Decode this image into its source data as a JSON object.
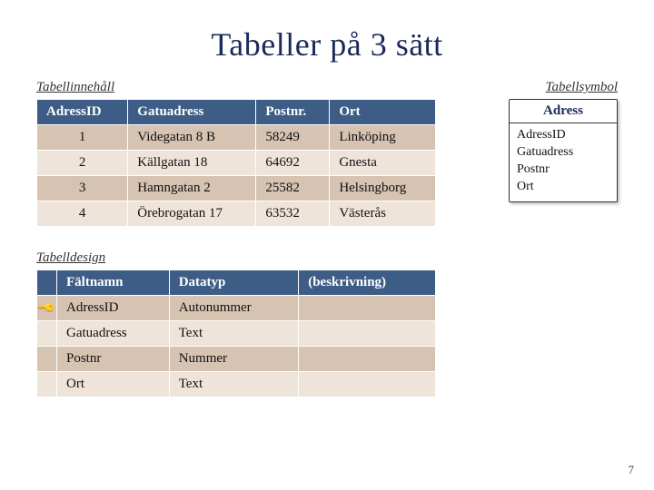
{
  "title": "Tabeller på 3 sätt",
  "labels": {
    "content": "Tabellinnehåll",
    "symbol": "Tabellsymbol",
    "design": "Tabelldesign"
  },
  "content_table": {
    "headers": {
      "id": "AdressID",
      "street": "Gatuadress",
      "zip": "Postnr.",
      "city": "Ort"
    },
    "rows": [
      {
        "id": "1",
        "street": "Videgatan 8 B",
        "zip": "58249",
        "city": "Linköping"
      },
      {
        "id": "2",
        "street": "Källgatan 18",
        "zip": "64692",
        "city": "Gnesta"
      },
      {
        "id": "3",
        "street": "Hamngatan 2",
        "zip": "25582",
        "city": "Helsingborg"
      },
      {
        "id": "4",
        "street": "Örebrogatan 17",
        "zip": "63532",
        "city": "Västerås"
      }
    ]
  },
  "symbol_box": {
    "title": "Adress",
    "fields": [
      "AdressID",
      "Gatuadress",
      "Postnr",
      "Ort"
    ]
  },
  "design_table": {
    "headers": {
      "key": "",
      "field": "Fältnamn",
      "type": "Datatyp",
      "desc": "(beskrivning)"
    },
    "rows": [
      {
        "is_key": true,
        "field": "AdressID",
        "type": "Autonummer",
        "desc": ""
      },
      {
        "is_key": false,
        "field": "Gatuadress",
        "type": "Text",
        "desc": ""
      },
      {
        "is_key": false,
        "field": "Postnr",
        "type": "Nummer",
        "desc": ""
      },
      {
        "is_key": false,
        "field": "Ort",
        "type": "Text",
        "desc": ""
      }
    ]
  },
  "page_number": "7",
  "chart_data": {
    "type": "table",
    "tables": [
      {
        "name": "Tabellinnehåll",
        "columns": [
          "AdressID",
          "Gatuadress",
          "Postnr.",
          "Ort"
        ],
        "rows": [
          [
            1,
            "Videgatan 8 B",
            58249,
            "Linköping"
          ],
          [
            2,
            "Källgatan 18",
            64692,
            "Gnesta"
          ],
          [
            3,
            "Hamngatan 2",
            25582,
            "Helsingborg"
          ],
          [
            4,
            "Örebrogatan 17",
            63532,
            "Västerås"
          ]
        ]
      },
      {
        "name": "Tabelldesign",
        "columns": [
          "PrimaryKey",
          "Fältnamn",
          "Datatyp",
          "(beskrivning)"
        ],
        "rows": [
          [
            true,
            "AdressID",
            "Autonummer",
            ""
          ],
          [
            false,
            "Gatuadress",
            "Text",
            ""
          ],
          [
            false,
            "Postnr",
            "Nummer",
            ""
          ],
          [
            false,
            "Ort",
            "Text",
            ""
          ]
        ]
      }
    ]
  }
}
